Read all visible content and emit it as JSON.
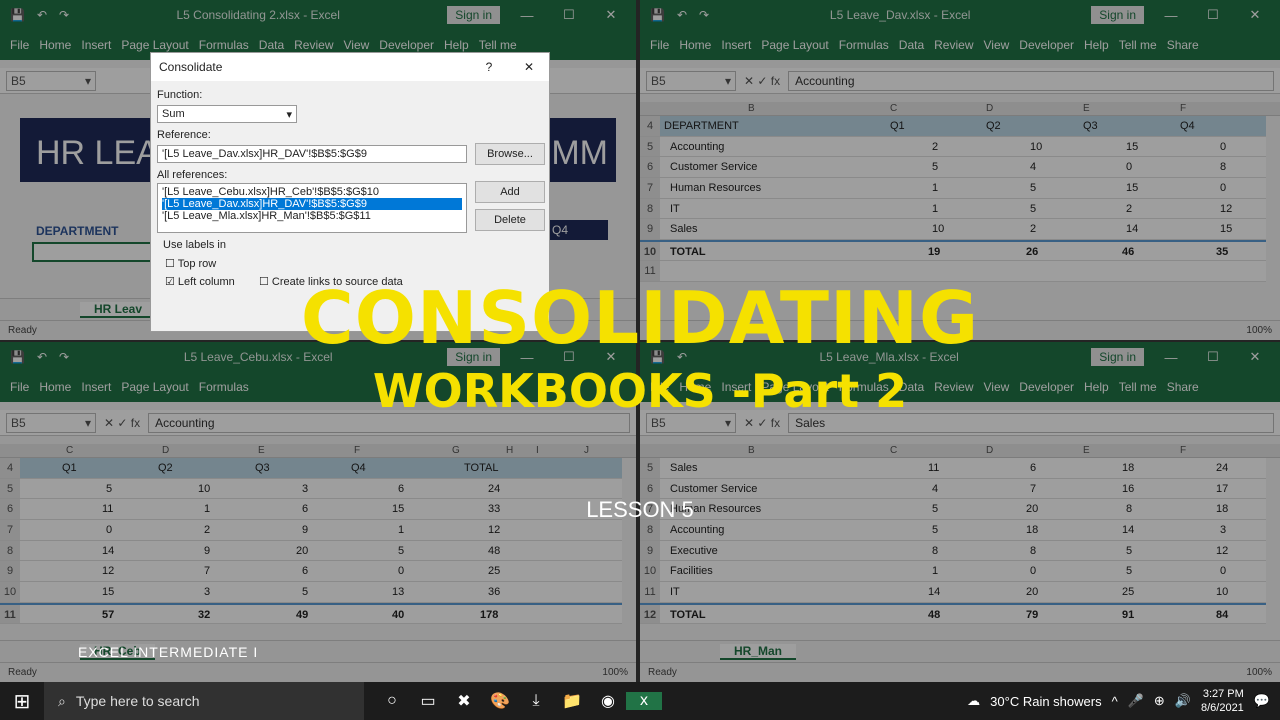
{
  "ribbon_tabs": [
    "File",
    "Home",
    "Insert",
    "Page Layout",
    "Formulas",
    "Data",
    "Review",
    "View",
    "Developer",
    "Help",
    "Tell me",
    "Share"
  ],
  "sign_in": "Sign in",
  "status_ready": "Ready",
  "zoom": "100%",
  "windows": {
    "w1": {
      "title": "L5 Consolidating 2.xlsx - Excel",
      "namebox": "B5",
      "banner": "HR LEA",
      "banner_right": "MM",
      "dept_label": "DEPARTMENT",
      "q4": "Q4",
      "sheet_tab": "HR Leav"
    },
    "w2": {
      "title": "L5 Leave_Dav.xlsx - Excel",
      "namebox": "B5",
      "formula": "Accounting",
      "cols": [
        "B",
        "C",
        "D",
        "E",
        "F"
      ],
      "header": {
        "rn": "4",
        "cells": [
          "DEPARTMENT",
          "Q1",
          "Q2",
          "Q3",
          "Q4"
        ]
      },
      "rows": [
        {
          "rn": "5",
          "cells": [
            "Accounting",
            "2",
            "10",
            "15",
            "0"
          ]
        },
        {
          "rn": "6",
          "cells": [
            "Customer Service",
            "5",
            "4",
            "0",
            "8"
          ]
        },
        {
          "rn": "7",
          "cells": [
            "Human Resources",
            "1",
            "5",
            "15",
            "0"
          ]
        },
        {
          "rn": "8",
          "cells": [
            "IT",
            "1",
            "5",
            "2",
            "12"
          ]
        },
        {
          "rn": "9",
          "cells": [
            "Sales",
            "10",
            "2",
            "14",
            "15"
          ]
        }
      ],
      "total": {
        "rn": "10",
        "cells": [
          "TOTAL",
          "19",
          "26",
          "46",
          "35"
        ]
      },
      "empty_rn": "11"
    },
    "w3": {
      "title": "L5 Leave_Cebu.xlsx - Excel",
      "namebox": "B5",
      "formula": "Accounting",
      "cols": [
        "C",
        "D",
        "E",
        "F",
        "G",
        "H",
        "I",
        "J"
      ],
      "header": {
        "rn": "4",
        "cells": [
          "Q1",
          "Q2",
          "Q3",
          "Q4",
          "TOTAL"
        ]
      },
      "rows": [
        {
          "rn": "5",
          "cells": [
            "5",
            "10",
            "3",
            "6",
            "24"
          ]
        },
        {
          "rn": "6",
          "cells": [
            "11",
            "1",
            "6",
            "15",
            "33"
          ]
        },
        {
          "rn": "7",
          "cells": [
            "0",
            "2",
            "9",
            "1",
            "12"
          ]
        },
        {
          "rn": "8",
          "cells": [
            "14",
            "9",
            "20",
            "5",
            "48"
          ]
        },
        {
          "rn": "9",
          "cells": [
            "12",
            "7",
            "6",
            "0",
            "25"
          ]
        },
        {
          "rn": "10",
          "cells": [
            "15",
            "3",
            "5",
            "13",
            "36"
          ]
        }
      ],
      "total": {
        "rn": "11",
        "cells": [
          "57",
          "32",
          "49",
          "40",
          "178"
        ]
      },
      "sheet_tab": "HR_Ceb"
    },
    "w4": {
      "title": "L5 Leave_Mla.xlsx - Excel",
      "namebox": "B5",
      "formula": "Sales",
      "cols": [
        "B",
        "C",
        "D",
        "E",
        "F"
      ],
      "rows": [
        {
          "rn": "5",
          "cells": [
            "Sales",
            "11",
            "6",
            "18",
            "24"
          ]
        },
        {
          "rn": "6",
          "cells": [
            "Customer Service",
            "4",
            "7",
            "16",
            "17"
          ]
        },
        {
          "rn": "7",
          "cells": [
            "Human Resources",
            "5",
            "20",
            "8",
            "18"
          ]
        },
        {
          "rn": "8",
          "cells": [
            "Accounting",
            "5",
            "18",
            "14",
            "3"
          ]
        },
        {
          "rn": "9",
          "cells": [
            "Executive",
            "8",
            "8",
            "5",
            "12"
          ]
        },
        {
          "rn": "10",
          "cells": [
            "Facilities",
            "1",
            "0",
            "5",
            "0"
          ]
        },
        {
          "rn": "11",
          "cells": [
            "IT",
            "14",
            "20",
            "25",
            "10"
          ]
        }
      ],
      "total": {
        "rn": "12",
        "cells": [
          "TOTAL",
          "48",
          "79",
          "91",
          "84"
        ]
      },
      "sheet_tab": "HR_Man"
    }
  },
  "dialog": {
    "title": "Consolidate",
    "function_label": "Function:",
    "function_value": "Sum",
    "reference_label": "Reference:",
    "reference_value": "'[L5 Leave_Dav.xlsx]HR_DAV'!$B$5:$G$9",
    "browse": "Browse...",
    "all_refs_label": "All references:",
    "refs": [
      "'[L5 Leave_Cebu.xlsx]HR_Ceb'!$B$5:$G$10",
      "'[L5 Leave_Dav.xlsx]HR_DAV'!$B$5:$G$9",
      "'[L5 Leave_Mla.xlsx]HR_Man'!$B$5:$G$11"
    ],
    "add": "Add",
    "delete": "Delete",
    "use_labels": "Use labels in",
    "top_row": "Top row",
    "left_column": "Left column",
    "create_links": "Create links to source data"
  },
  "overlay": {
    "title": "CONSOLIDATING",
    "subtitle": "WORKBOOKS -Part 2",
    "lesson": "LESSON 5",
    "course": "EXCEL INTERMEDIATE I"
  },
  "taskbar": {
    "search_placeholder": "Type here to search",
    "weather": "30°C  Rain showers",
    "time": "3:27 PM",
    "date": "8/6/2021"
  }
}
